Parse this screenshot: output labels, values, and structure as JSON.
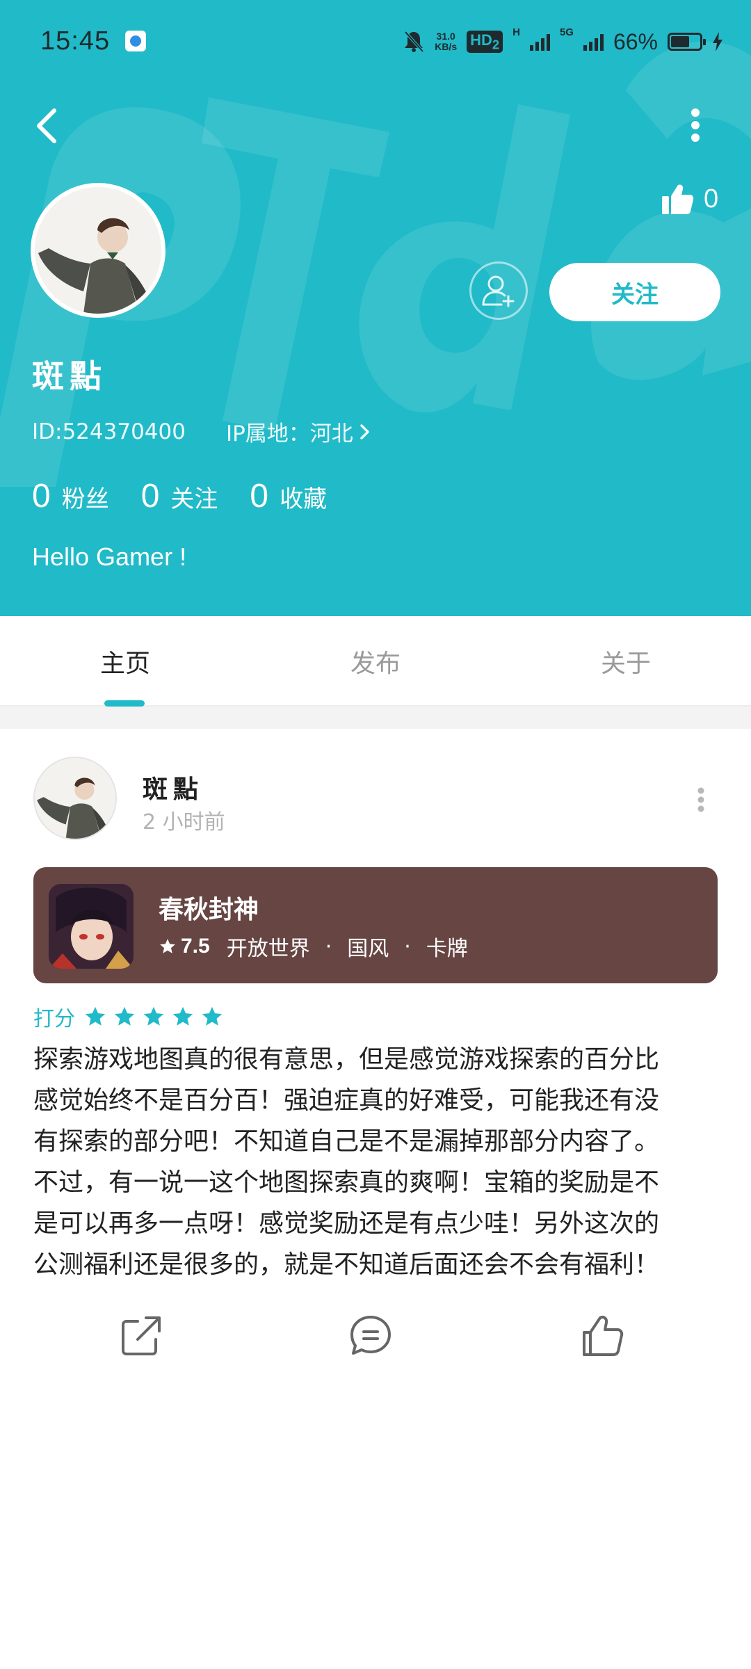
{
  "status_bar": {
    "time": "15:45",
    "net_speed_value": "31.0",
    "net_speed_unit": "KB/s",
    "hd_label": "HD",
    "hd_sub": "2",
    "net_h": "H",
    "net_5g": "5G",
    "battery": "66%"
  },
  "header": {
    "likes_count": "0",
    "follow_label": "关注"
  },
  "profile": {
    "name": "斑點",
    "id": "ID:524370400",
    "ip_location": "IP属地：河北",
    "stats": [
      {
        "num": "0",
        "label": "粉丝"
      },
      {
        "num": "0",
        "label": "关注"
      },
      {
        "num": "0",
        "label": "收藏"
      }
    ],
    "bio": "Hello Gamer !"
  },
  "tabs": [
    {
      "label": "主页",
      "active": true
    },
    {
      "label": "发布",
      "active": false
    },
    {
      "label": "关于",
      "active": false
    }
  ],
  "post": {
    "author": "斑點",
    "time": "2 小时前",
    "game": {
      "name": "春秋封神",
      "score": "7.5",
      "tags": [
        "开放世界",
        "国风",
        "卡牌"
      ],
      "separator": "·"
    },
    "rating_label": "打分",
    "rating_stars": 5,
    "review_lines": [
      "探索游戏地图真的很有意思，但是感觉游戏探索的百分比",
      "感觉始终不是百分百！强迫症真的好难受，可能我还有没",
      "有探索的部分吧！不知道自己是不是漏掉那部分内容了。",
      "不过，有一说一这个地图探索真的爽啊！宝箱的奖励是不",
      "是可以再多一点呀！感觉奖励还是有点少哇！另外这次的",
      "公测福利还是很多的，就是不知道后面还会不会有福利！"
    ]
  },
  "colors": {
    "accent": "#21bac8",
    "game_card_bg": "#664543",
    "muted_text": "#9a9a9a"
  },
  "icons": {
    "back": "chevron-left-icon",
    "more": "more-vertical-icon",
    "like": "thumbs-up-icon",
    "add_friend": "add-user-icon",
    "ip_arrow": "chevron-right-icon",
    "star": "star-icon",
    "share": "share-external-icon",
    "comment": "comment-icon"
  }
}
